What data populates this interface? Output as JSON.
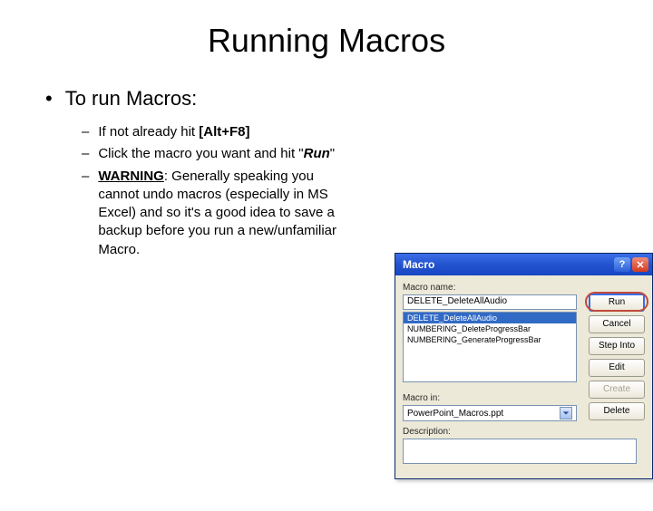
{
  "slide": {
    "title": "Running Macros",
    "l1": "To run Macros:",
    "l2a_pre": "If not already hit ",
    "l2a_bold": "[Alt+F8]",
    "l2b_pre": "Click the macro you want and hit \"",
    "l2b_run": "Run",
    "l2b_post": "\"",
    "l2c_warn": "WARNING",
    "l2c_rest": ": Generally speaking you cannot undo macros (especially in MS Excel) and so it's a good idea to save a backup before you run a new/unfamiliar Macro."
  },
  "dialog": {
    "title": "Macro",
    "name_label": "Macro name:",
    "name_value": "DELETE_DeleteAllAudio",
    "items": [
      "DELETE_DeleteAllAudio",
      "NUMBERING_DeleteProgressBar",
      "NUMBERING_GenerateProgressBar"
    ],
    "buttons": {
      "run": "Run",
      "cancel": "Cancel",
      "step": "Step Into",
      "edit": "Edit",
      "create": "Create",
      "delete": "Delete"
    },
    "macroin_label": "Macro in:",
    "macroin_value": "PowerPoint_Macros.ppt",
    "desc_label": "Description:"
  }
}
